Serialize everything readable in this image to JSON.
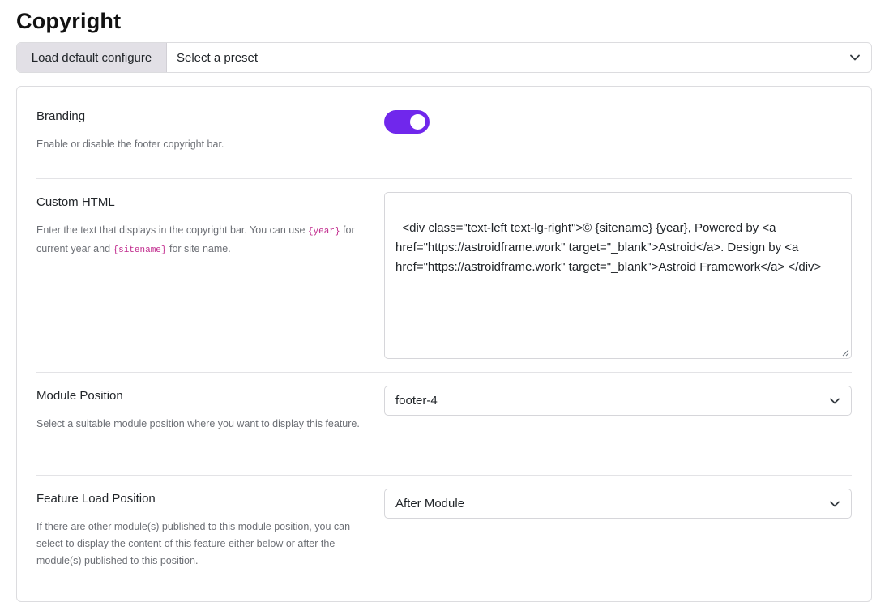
{
  "page": {
    "title": "Copyright"
  },
  "preset": {
    "load_default_label": "Load default configure",
    "select_value": "Select a preset"
  },
  "branding": {
    "label": "Branding",
    "description": "Enable or disable the footer copyright bar.",
    "enabled": true,
    "toggle_color": "#7027ec"
  },
  "custom_html": {
    "label": "Custom HTML",
    "desc_part1": "Enter the text that displays in the copyright bar. You can use ",
    "desc_code1": "{year}",
    "desc_part2": " for current year and ",
    "desc_code2": "{sitename}",
    "desc_part3": " for site name.",
    "value": "<div class=\"text-left text-lg-right\">© {sitename} {year}, Powered by <a href=\"https://astroidframe.work\" target=\"_blank\">Astroid</a>. Design by <a href=\"https://astroidframe.work\" target=\"_blank\">Astroid Framework</a> </div>"
  },
  "module_position": {
    "label": "Module Position",
    "description": "Select a suitable module position where you want to display this feature.",
    "value": "footer-4"
  },
  "feature_load_position": {
    "label": "Feature Load Position",
    "description": "If there are other module(s) published to this module position, you can select to display the content of this feature either below or after the module(s) published to this position.",
    "value": "After Module"
  }
}
